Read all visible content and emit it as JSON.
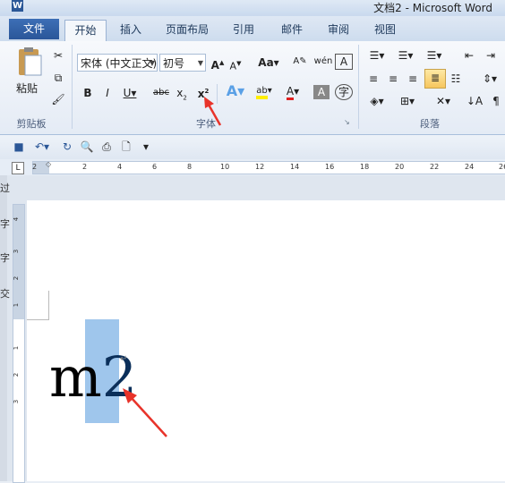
{
  "window": {
    "title": "文档2 - Microsoft Word",
    "logo_letter": "W"
  },
  "tabs": [
    "文件",
    "开始",
    "插入",
    "页面布局",
    "引用",
    "邮件",
    "审阅",
    "视图"
  ],
  "clipboard": {
    "paste_label": "粘贴",
    "group_label": "剪贴板"
  },
  "font": {
    "font_name": "宋体 (中文正文)",
    "font_size": "初号",
    "group_label": "字体"
  },
  "paragraph": {
    "group_label": "段落"
  },
  "ruler": {
    "numbers": [
      "2",
      "2",
      "4",
      "6",
      "8",
      "10",
      "12",
      "14",
      "16",
      "18",
      "20",
      "22",
      "24",
      "26"
    ]
  },
  "vruler": {
    "numbers": [
      "4",
      "3",
      "2",
      "1",
      "1",
      "2",
      "3"
    ]
  },
  "left_edge_chars": [
    "过",
    "字",
    "字",
    "交"
  ],
  "document": {
    "base_text": "m",
    "superscript_text": "2"
  },
  "colors": {
    "file_tab": "#2a5699",
    "selection": "#9fc6ec",
    "highlight_button": "#f6c65e",
    "arrow": "#e8332a"
  }
}
